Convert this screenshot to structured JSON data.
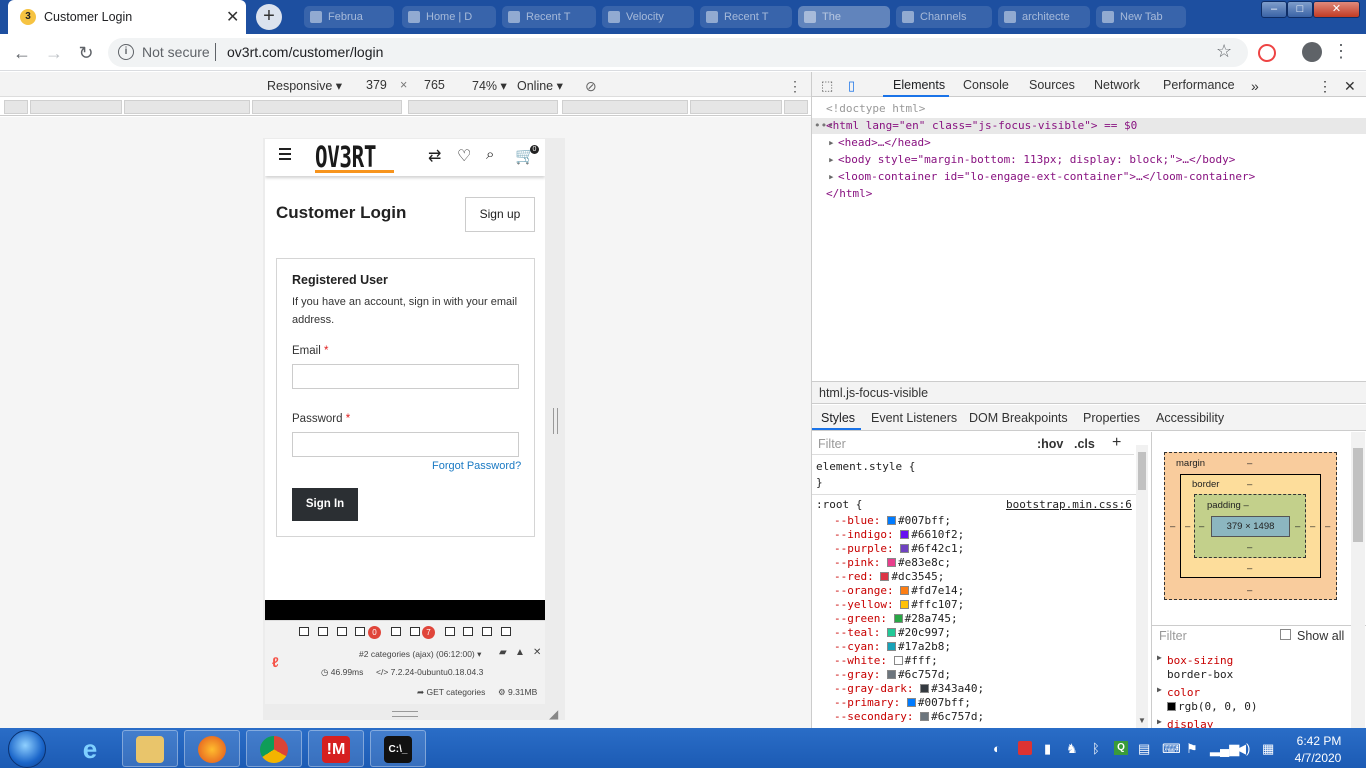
{
  "browser": {
    "active_tab": {
      "favicon": "3",
      "title": "Customer Login"
    },
    "background_tabs": [
      "Februa",
      "Home | D",
      "Recent T",
      "Velocity",
      "Recent T",
      "The",
      "Channels",
      "architecte",
      "New Tab"
    ],
    "window_controls": {
      "minimize": "‒",
      "maximize": "□",
      "close": "✕"
    },
    "address": {
      "security_label": "Not secure",
      "url": "ov3rt.com/customer/login"
    }
  },
  "device_toolbar": {
    "device": "Responsive",
    "width": "379",
    "times": "×",
    "height": "765",
    "zoom": "74%",
    "network": "Online"
  },
  "site": {
    "logo": "OV3RT",
    "cart_count": "0",
    "page_title": "Customer Login",
    "signup_label": "Sign up",
    "card": {
      "title": "Registered User",
      "description": "If you have an account, sign in with your email address.",
      "email_label": "Email",
      "password_label": "Password",
      "required_mark": "*",
      "email_value": "",
      "password_value": "",
      "forgot_label": "Forgot Password?",
      "signin_label": "Sign In"
    },
    "debugbar": {
      "badge_a": "0",
      "badge_b": "7",
      "request_label": "#2 categories (ajax) (06:12:00)",
      "time": "46.99ms",
      "version": "7.2.24-0ubuntu0.18.04.3",
      "route": "GET categories",
      "memory": "9.31MB"
    }
  },
  "devtools": {
    "tabs": [
      "Elements",
      "Console",
      "Sources",
      "Network",
      "Performance"
    ],
    "more": "»",
    "dom": {
      "doctype": "<!doctype html>",
      "html_open": "<html lang=\"en\" class=\"js-focus-visible\"> == $0",
      "head": "<head>…</head>",
      "body": "<body style=\"margin-bottom: 113px; display: block;\">…</body>",
      "loom": "<loom-container id=\"lo-engage-ext-container\">…</loom-container>",
      "html_close": "</html>"
    },
    "breadcrumb": "html.js-focus-visible",
    "subtabs": [
      "Styles",
      "Event Listeners",
      "DOM Breakpoints",
      "Properties",
      "Accessibility"
    ],
    "filter_placeholder": "Filter",
    "hov": ":hov",
    "cls": ".cls",
    "plus": "+",
    "element_style": "element.style {",
    "close_brace": "}",
    "root_selector": ":root {",
    "root_source": "bootstrap.min.css:6",
    "vars": [
      {
        "name": "--blue:",
        "value": "#007bff;",
        "color": "#007bff"
      },
      {
        "name": "--indigo:",
        "value": "#6610f2;",
        "color": "#6610f2"
      },
      {
        "name": "--purple:",
        "value": "#6f42c1;",
        "color": "#6f42c1"
      },
      {
        "name": "--pink:",
        "value": "#e83e8c;",
        "color": "#e83e8c"
      },
      {
        "name": "--red:",
        "value": "#dc3545;",
        "color": "#dc3545"
      },
      {
        "name": "--orange:",
        "value": "#fd7e14;",
        "color": "#fd7e14"
      },
      {
        "name": "--yellow:",
        "value": "#ffc107;",
        "color": "#ffc107"
      },
      {
        "name": "--green:",
        "value": "#28a745;",
        "color": "#28a745"
      },
      {
        "name": "--teal:",
        "value": "#20c997;",
        "color": "#20c997"
      },
      {
        "name": "--cyan:",
        "value": "#17a2b8;",
        "color": "#17a2b8"
      },
      {
        "name": "--white:",
        "value": "#fff;",
        "color": "#ffffff"
      },
      {
        "name": "--gray:",
        "value": "#6c757d;",
        "color": "#6c757d"
      },
      {
        "name": "--gray-dark:",
        "value": "#343a40;",
        "color": "#343a40"
      },
      {
        "name": "--primary:",
        "value": "#007bff;",
        "color": "#007bff"
      },
      {
        "name": "--secondary:",
        "value": "#6c757d;",
        "color": "#6c757d"
      }
    ],
    "box_model": {
      "margin": "margin",
      "border": "border",
      "padding": "padding",
      "dash": "–",
      "content": "379 × 1498"
    },
    "computed": {
      "filter_placeholder": "Filter",
      "show_all": "Show all",
      "props": [
        {
          "name": "box-sizing",
          "value": "border-box"
        },
        {
          "name": "color",
          "value": "rgb(0, 0, 0)"
        },
        {
          "name": "display",
          "value": ""
        }
      ]
    }
  },
  "taskbar": {
    "time": "6:42 PM",
    "date": "4/7/2020"
  }
}
